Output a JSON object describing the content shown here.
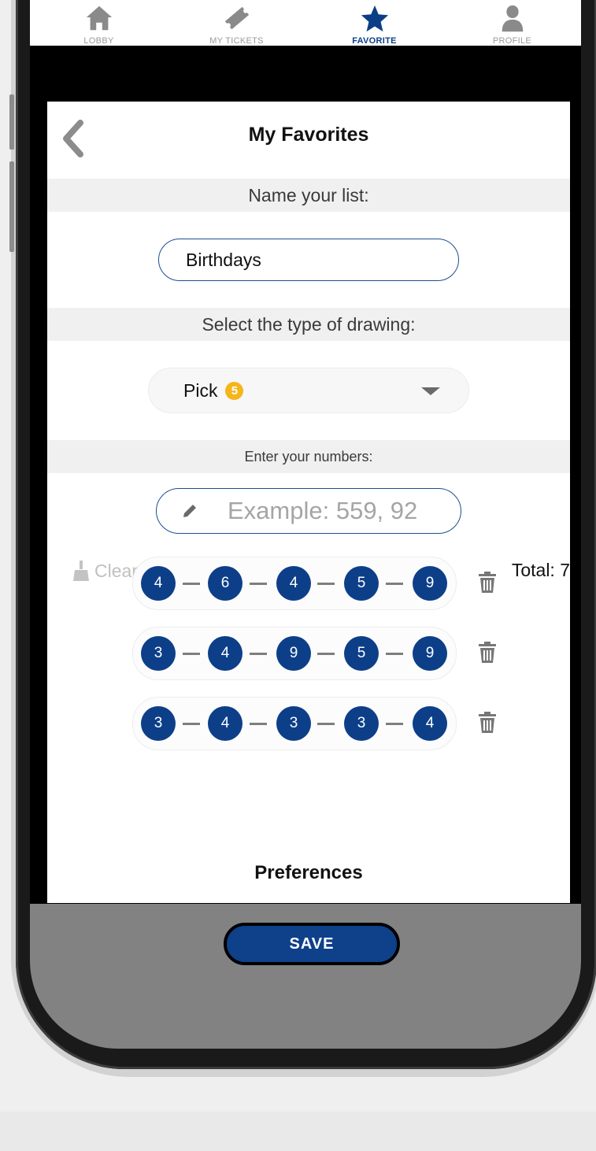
{
  "nav": {
    "items": [
      {
        "label": "LOBBY",
        "icon": "house-icon",
        "active": false
      },
      {
        "label": "MY TICKETS",
        "icon": "ticket-icon",
        "active": false
      },
      {
        "label": "FAVORITE",
        "icon": "star-icon",
        "active": true
      },
      {
        "label": "PROFILE",
        "icon": "person-icon",
        "active": false
      }
    ]
  },
  "header": {
    "title": "My Favorites",
    "back_icon": "chevron-left-icon"
  },
  "name_section": {
    "label": "Name your list:",
    "value": "Birthdays"
  },
  "drawing_section": {
    "label": "Select the type of drawing:",
    "selected_text": "Pick",
    "selected_badge": "5"
  },
  "numbers_section": {
    "label": "Enter your numbers:",
    "placeholder": "Example: 559, 92",
    "clear_all_label": "Clear all",
    "total_label": "Total: 7"
  },
  "favorite_numbers": [
    [
      "4",
      "6",
      "4",
      "5",
      "9"
    ],
    [
      "3",
      "4",
      "9",
      "5",
      "9"
    ],
    [
      "3",
      "4",
      "3",
      "3",
      "4"
    ]
  ],
  "preferences_title": "Preferences",
  "save_label": "SAVE",
  "colors": {
    "brand_blue": "#0d3f89",
    "badge_yellow": "#f5b51b"
  }
}
